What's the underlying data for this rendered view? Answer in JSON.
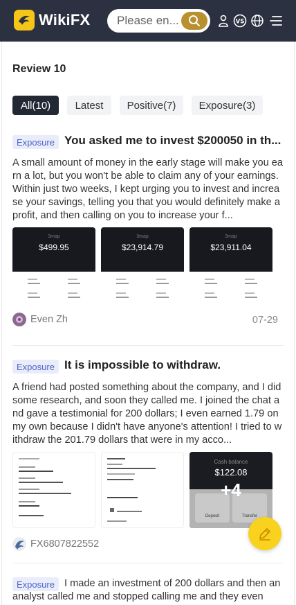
{
  "brand": {
    "name": "WikiFX",
    "logo_color": "#f5c518"
  },
  "search": {
    "placeholder": "Please en..."
  },
  "header_icons": [
    "user-icon",
    "vs-icon",
    "globe-icon",
    "menu-icon"
  ],
  "section": {
    "title": "Review 10"
  },
  "tabs": [
    {
      "label": "All(10)",
      "active": true
    },
    {
      "label": "Latest",
      "active": false
    },
    {
      "label": "Positive(7)",
      "active": false
    },
    {
      "label": "Exposure(3)",
      "active": false
    }
  ],
  "reviews": [
    {
      "badge": "Exposure",
      "title": "You asked me to invest $200050 in th...",
      "body": "A small amount of money in the early stage will make you earn a lot, but you won't be able to claim any of your earnings. Within just two weeks, I kept urging you to invest and increase your savings, telling you that you would definitely make a profit, and then calling on you to increase your f...",
      "images": [
        {
          "amount": "$499.95"
        },
        {
          "amount": "$23,914.79"
        },
        {
          "amount": "$23,911.04"
        }
      ],
      "author": "Even Zh",
      "date": "07-29"
    },
    {
      "badge": "Exposure",
      "title": "It is impossible to withdraw.",
      "body": "A friend had posted something about the company, and I did some research, and soon they called me. I joined the chat and gave a testimonial for 200 dollars; I even earned 1.79 on my own because I didn't have anyone's attention! I tried to withdraw the 201.79 dollars that were in my acco...",
      "images_extra": {
        "amount": "$122.08",
        "more": "+4",
        "deposit_label": "Deposit",
        "transfer_label": "Transfer"
      },
      "author": "FX6807822552",
      "date": ""
    },
    {
      "badge": "Exposure",
      "body": "I made an investment of 200 dollars and then an analyst called me and stopped calling me and they even"
    }
  ]
}
